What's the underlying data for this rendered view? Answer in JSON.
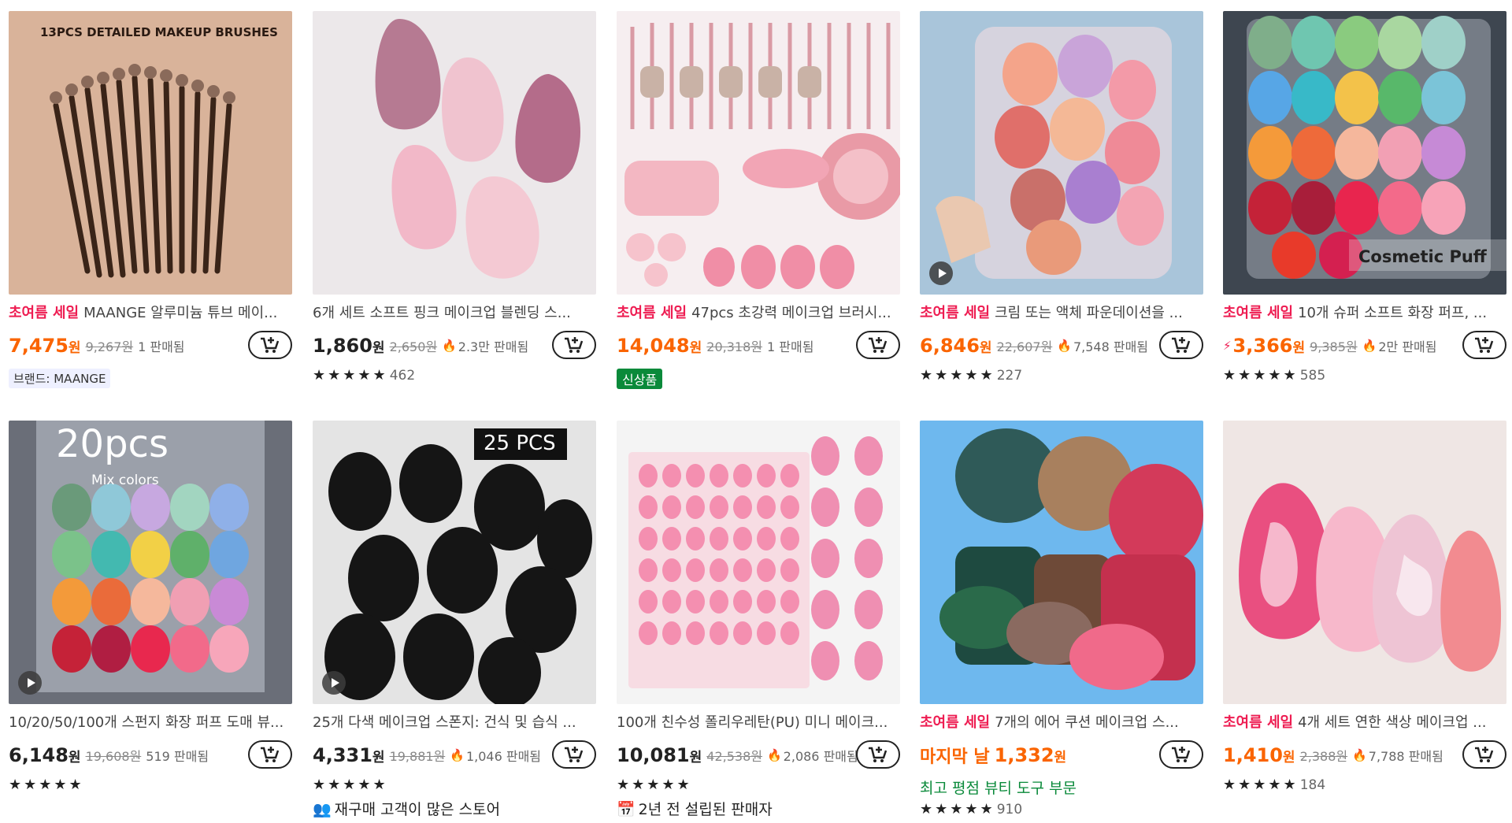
{
  "products": [
    {
      "image_text": "13PCS DETAILED MAKEUP BRUSHES",
      "sale_tag": "초여름 세일",
      "title": "MAANGE 알루미늄 튜브 메이...",
      "price": "7,475",
      "won": "원",
      "original": "9,267원",
      "sold": "1 판매됨",
      "brand": "브랜드: MAANGE"
    },
    {
      "title": "6개 세트 소프트 핑크 메이크업 블렌딩 스...",
      "price": "1,860",
      "won": "원",
      "original": "2,650원",
      "sold": "2.3만 판매됨",
      "stars": "★★★★★",
      "reviews": "462"
    },
    {
      "sale_tag": "초여름 세일",
      "title": "47pcs 초강력 메이크업 브러시...",
      "price": "14,048",
      "won": "원",
      "original": "20,318원",
      "sold": "1 판매됨",
      "new_badge": "신상품"
    },
    {
      "sale_tag": "초여름 세일",
      "title": "크림 또는 액체 파운데이션을 ...",
      "price": "6,846",
      "won": "원",
      "original": "22,607원",
      "sold": "7,548 판매됨",
      "stars": "★★★★★",
      "reviews": "227"
    },
    {
      "image_text": "Cosmetic Puff",
      "sale_tag": "초여름 세일",
      "title": "10개 슈퍼 소프트 화장 퍼프, ...",
      "price": "3,366",
      "won": "원",
      "original": "9,385원",
      "sold": "2만 판매됨",
      "stars": "★★★★★",
      "reviews": "585"
    },
    {
      "image_text": "20pcs",
      "image_subtext": "Mix colors",
      "title": "10/20/50/100개 스펀지 화장 퍼프 도매 뷰...",
      "price": "6,148",
      "won": "원",
      "original": "19,608원",
      "sold": "519 판매됨",
      "stars": "★★★★★"
    },
    {
      "image_text": "25 PCS",
      "title": "25개 다색 메이크업 스폰지: 건식 및 습식 ...",
      "price": "4,331",
      "won": "원",
      "original": "19,881원",
      "sold": "1,046 판매됨",
      "stars": "★★★★★",
      "extra": "재구매 고객이 많은 스토어"
    },
    {
      "title": "100개 친수성 폴리우레탄(PU) 미니 메이크...",
      "price": "10,081",
      "won": "원",
      "original": "42,538원",
      "sold": "2,086 판매됨",
      "stars": "★★★★★",
      "extra": "2년 전 설립된 판매자"
    },
    {
      "sale_tag": "초여름 세일",
      "title": "7개의 에어 쿠션 메이크업 스...",
      "last_day": "마지막 날",
      "price": "1,332",
      "won": "원",
      "best": "최고 평점 뷰티 도구 부문",
      "stars": "★★★★★",
      "reviews": "910"
    },
    {
      "sale_tag": "초여름 세일",
      "title": "4개 세트 연한 색상 메이크업 ...",
      "price": "1,410",
      "won": "원",
      "original": "2,388원",
      "sold": "7,788 판매됨",
      "stars": "★★★★★",
      "reviews": "184"
    }
  ],
  "colors": {
    "sale": "#ee1d52",
    "orange_price": "#fa6400",
    "green": "#0a8a3a"
  }
}
